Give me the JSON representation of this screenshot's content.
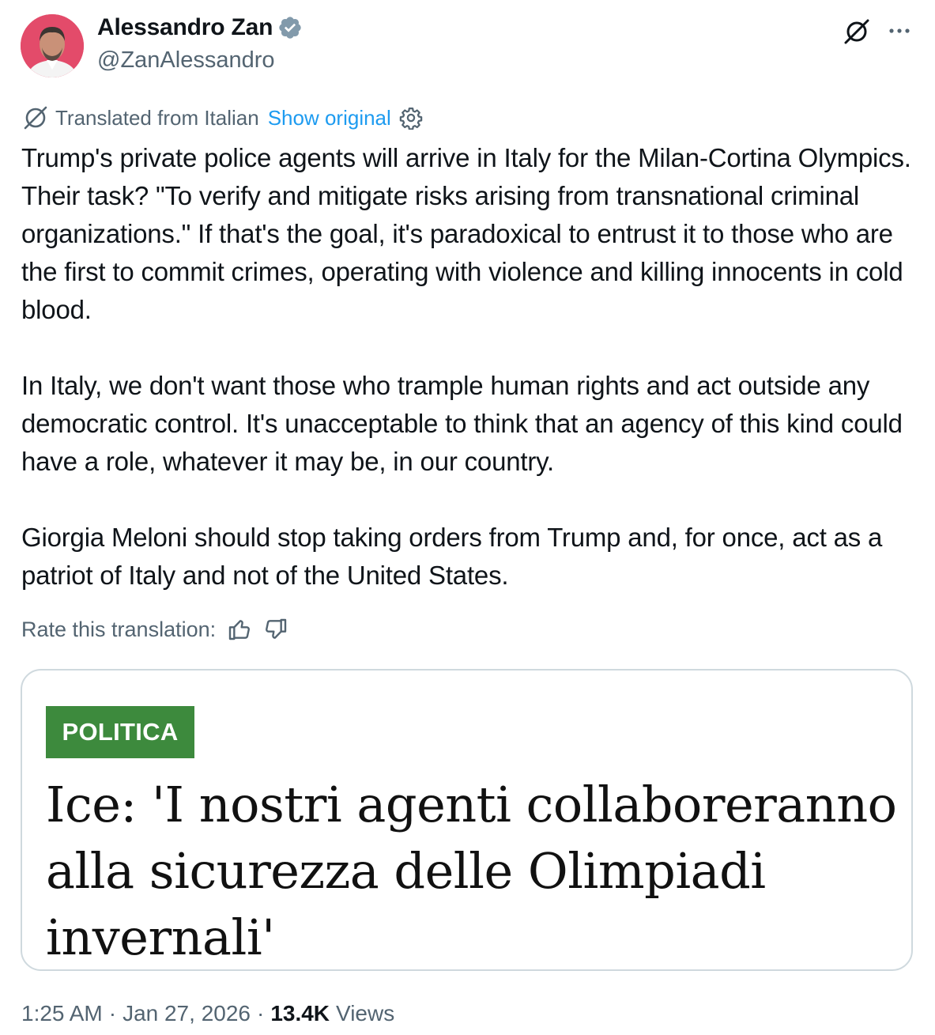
{
  "author": {
    "name": "Alessandro Zan",
    "handle": "@ZanAlessandro",
    "verified": true
  },
  "translation": {
    "label": "Translated from Italian",
    "show_original": "Show original",
    "rate_label": "Rate this translation:"
  },
  "tweet": {
    "paragraphs": [
      "Trump's private police agents will arrive in Italy for the Milan-Cortina Olympics. Their task? \"To verify and mitigate risks arising from transnational criminal organizations.\" If that's the goal, it's paradoxical to entrust it to those who are the first to commit crimes, operating with violence and killing innocents in cold blood.",
      "In Italy, we don't want those who trample human rights and act outside any democratic control. It's unacceptable to think that an agency of this kind could have a role, whatever it may be, in our country.",
      "Giorgia Meloni should stop taking orders from Trump and, for once, act as a patriot of Italy and not of the United States."
    ]
  },
  "card": {
    "badge": "POLITICA",
    "headline": "Ice: 'I nostri agenti collaboreranno alla sicurezza delle Olimpiadi invernali'",
    "badge_color": "#3d8a3d"
  },
  "meta": {
    "time": "1:25 AM",
    "date": "Jan 27, 2026",
    "views_count": "13.4K",
    "views_label": "Views",
    "separator": "·"
  },
  "colors": {
    "accent": "#1d9bf0",
    "secondary_text": "#536471",
    "primary_text": "#0f1419"
  },
  "icons": {
    "grok": "grok-icon",
    "more": "more-icon",
    "translate": "translate-icon",
    "settings": "gear-icon",
    "like": "thumbs-up-icon",
    "dislike": "thumbs-down-icon"
  }
}
